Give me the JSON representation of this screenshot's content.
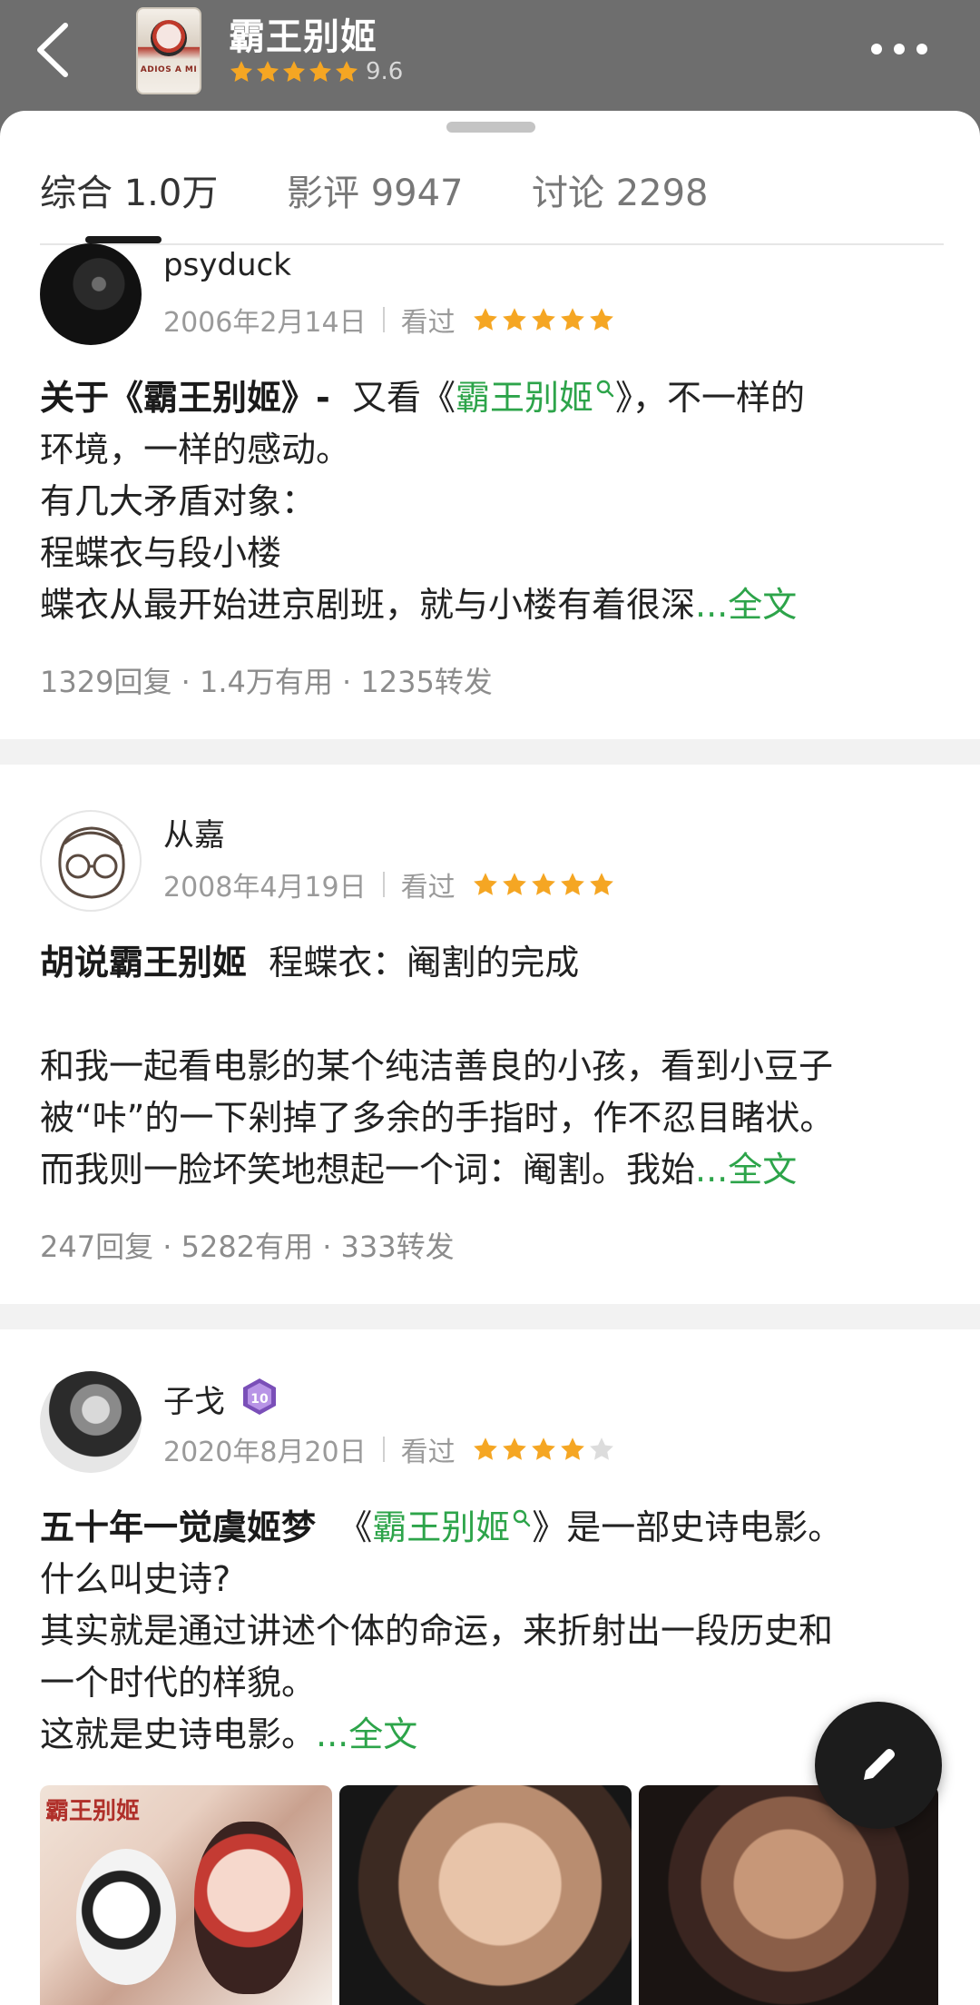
{
  "header": {
    "title": "霸王别姬",
    "rating": "9.6",
    "stars": 5,
    "poster_text": "ADIOS A MI"
  },
  "tabs": [
    {
      "label": "综合 1.0万",
      "active": true
    },
    {
      "label": "影评 9947",
      "active": false
    },
    {
      "label": "讨论 2298",
      "active": false
    }
  ],
  "reviews": [
    {
      "author": "psyduck",
      "date": "2006年2月14日",
      "status": "看过",
      "stars": 5,
      "title": "关于《霸王别姬》-",
      "lines": [
        {
          "prefix": "又看《",
          "link": "霸王别姬",
          "suffix": "》，不一样的"
        },
        "环境，一样的感动。",
        "有几大矛盾对象：",
        "程蝶衣与段小楼",
        "蝶衣从最开始进京剧班，就与小楼有着很深"
      ],
      "more": "...全文",
      "stats": "1329回复 · 1.4万有用 · 1235转发"
    },
    {
      "author": "从嘉",
      "date": "2008年4月19日",
      "status": "看过",
      "stars": 5,
      "title": "胡说霸王别姬",
      "lines": [
        "程蝶衣：阉割的完成",
        "",
        "和我一起看电影的某个纯洁善良的小孩，看到小豆子",
        "被“咔”的一下剁掉了多余的手指时，作不忍目睹状。",
        "而我则一脸坏笑地想起一个词：阉割。我始"
      ],
      "more": "...全文",
      "stats": "247回复 · 5282有用 · 333转发"
    },
    {
      "author": "子戈",
      "badge": "10",
      "date": "2020年8月20日",
      "status": "看过",
      "stars": 4,
      "title": "五十年一觉虞姬梦",
      "lines": [
        {
          "prefix": "《",
          "link": "霸王别姬",
          "suffix": "》是一部史诗电影。"
        },
        "什么叫史诗?",
        "其实就是通过讲述个体的命运，来折射出一段历史和",
        "一个时代的样貌。",
        "这就是史诗电影。"
      ],
      "more": "...全文",
      "stats": ""
    }
  ],
  "photos": [
    {
      "caption": "霸王别姬"
    },
    {
      "caption": ""
    },
    {
      "caption": ""
    }
  ],
  "colors": {
    "header_bg": "#6e6e6e",
    "accent_green": "#2da44a",
    "star_orange": "#f5a623"
  },
  "icons": {
    "back": "chevron-left-icon",
    "more": "more-dots-icon",
    "write": "pencil-icon"
  }
}
